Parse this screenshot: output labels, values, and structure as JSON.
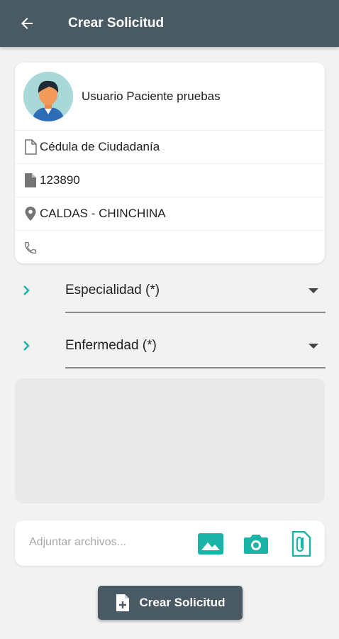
{
  "appbar": {
    "title": "Crear Solicitud"
  },
  "user": {
    "name": "Usuario  Paciente pruebas",
    "document_type": "Cédula de Ciudadanía",
    "document_number": "123890",
    "location": "CALDAS - CHINCHINA",
    "phone": ""
  },
  "form": {
    "specialty_label": "Especialidad (*)",
    "disease_label": "Enfermedad (*)",
    "attach_placeholder": "Adjuntar archivos..."
  },
  "actions": {
    "create_label": "Crear Solicitud"
  },
  "colors": {
    "header": "#4a5a64",
    "accent": "#1bb3a6",
    "avatar_bg": "#a8d8d8"
  }
}
